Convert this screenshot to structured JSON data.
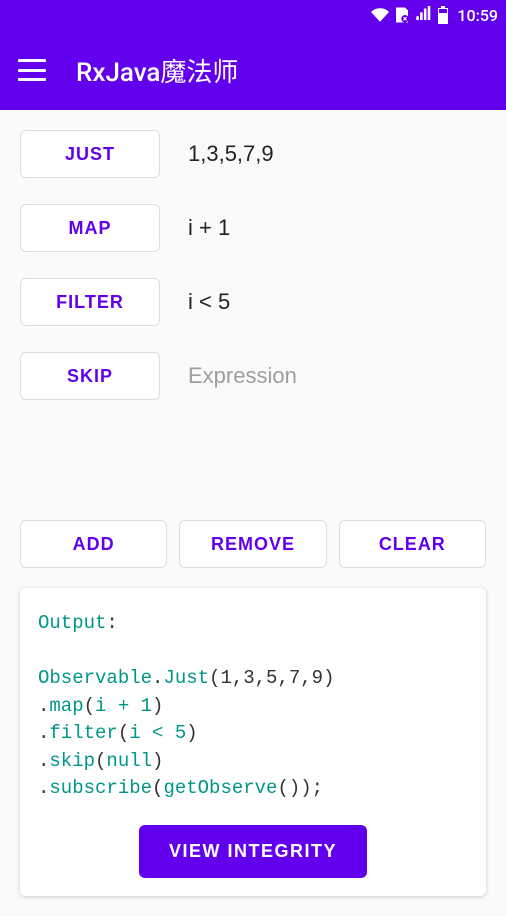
{
  "status": {
    "time": "10:59"
  },
  "header": {
    "title": "RxJava魔法师"
  },
  "operators": [
    {
      "label": "JUST",
      "value": "1,3,5,7,9",
      "placeholder": ""
    },
    {
      "label": "MAP",
      "value": "i + 1",
      "placeholder": ""
    },
    {
      "label": "FILTER",
      "value": "i < 5",
      "placeholder": ""
    },
    {
      "label": "SKIP",
      "value": "",
      "placeholder": "Expression"
    }
  ],
  "actions": {
    "add": "ADD",
    "remove": "REMOVE",
    "clear": "CLEAR"
  },
  "output": {
    "label": "Output",
    "observable": "Observable",
    "just": "Just",
    "just_args": "(1,3,5,7,9)",
    "map": "map",
    "map_args": "i + 1",
    "filter": "filter",
    "filter_args": "i < 5",
    "skip": "skip",
    "skip_args": "null",
    "subscribe": "subscribe",
    "getObserve": "getObserve",
    "view_integrity": "VIEW INTEGRITY"
  }
}
